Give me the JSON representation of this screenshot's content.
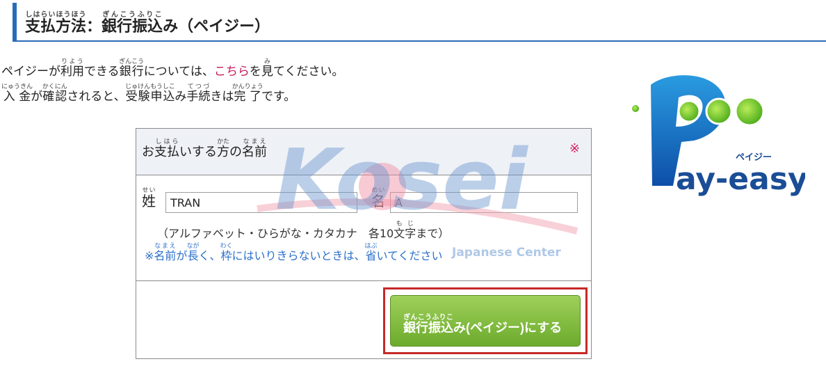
{
  "heading": {
    "title_seg1": "支払",
    "title_seg1_ruby": "しはらい",
    "title_seg2": "方法",
    "title_seg2_ruby": "ほうほう",
    "title_seg3": "：",
    "title_seg4": "銀行振込",
    "title_seg4_ruby": "ぎんこうふりこ",
    "title_seg5": "み（ペイジー）"
  },
  "intro": {
    "line1_a": "ペイジーが",
    "line1_b": "利用",
    "line1_b_ruby": "りよう",
    "line1_c": "できる",
    "line1_d": "銀行",
    "line1_d_ruby": "ぎんこう",
    "line1_e": "については、",
    "line1_link": "こちら",
    "line1_f": "を",
    "line1_g": "見",
    "line1_g_ruby": "み",
    "line1_h": "てください。",
    "line2_a": "入金",
    "line2_a_ruby": "にゅうきん",
    "line2_b": "が",
    "line2_c": "確認",
    "line2_c_ruby": "かくにん",
    "line2_d": "されると、",
    "line2_e": "受験申込",
    "line2_e_ruby": "じゅけんもうしこ",
    "line2_f": "み",
    "line2_g": "手続",
    "line2_g_ruby": "てつづ",
    "line2_h": "きは",
    "line2_i": "完了",
    "line2_i_ruby": "かんりょう",
    "line2_j": "です。"
  },
  "form": {
    "head_a": "お",
    "head_b": "支払",
    "head_b_ruby": "しはら",
    "head_c": "いする",
    "head_d": "方",
    "head_d_ruby": "かた",
    "head_e": "の",
    "head_f": "名前",
    "head_f_ruby": "なまえ",
    "required_mark": "※",
    "sei_label": "姓",
    "sei_ruby": "せい",
    "sei_value": "TRAN",
    "mei_label": "名",
    "mei_ruby": "めい",
    "mei_value": "A",
    "hint_a": "（アルファベット・ひらがな・カタカナ　各10",
    "hint_b": "文字",
    "hint_b_ruby": "もじ",
    "hint_c": "まで）",
    "note_a": "※",
    "note_b": "名前",
    "note_b_ruby": "なまえ",
    "note_c": "が",
    "note_d": "長",
    "note_d_ruby": "なが",
    "note_e": "く、",
    "note_f": "枠",
    "note_f_ruby": "わく",
    "note_g": "にはいりきらないときは、",
    "note_h": "省",
    "note_h_ruby": "はぶ",
    "note_i": "いてください",
    "submit_a": "銀行振込",
    "submit_a_ruby": "ぎんこうふりこ",
    "submit_b": "み(ペイジー)にする"
  },
  "logo": {
    "kana": "ペイジー",
    "word": "ay-easy"
  },
  "watermark": {
    "brand": "Kosei",
    "sub": "Japanese Center"
  },
  "colors": {
    "accent_blue": "#2b6bb7",
    "link_pink": "#c2185b",
    "note_blue": "#2c70c9",
    "button_green": "#7cb83a",
    "highlight_red": "#c62828"
  },
  "icons": [
    "pay-easy-logo",
    "kosei-watermark"
  ]
}
